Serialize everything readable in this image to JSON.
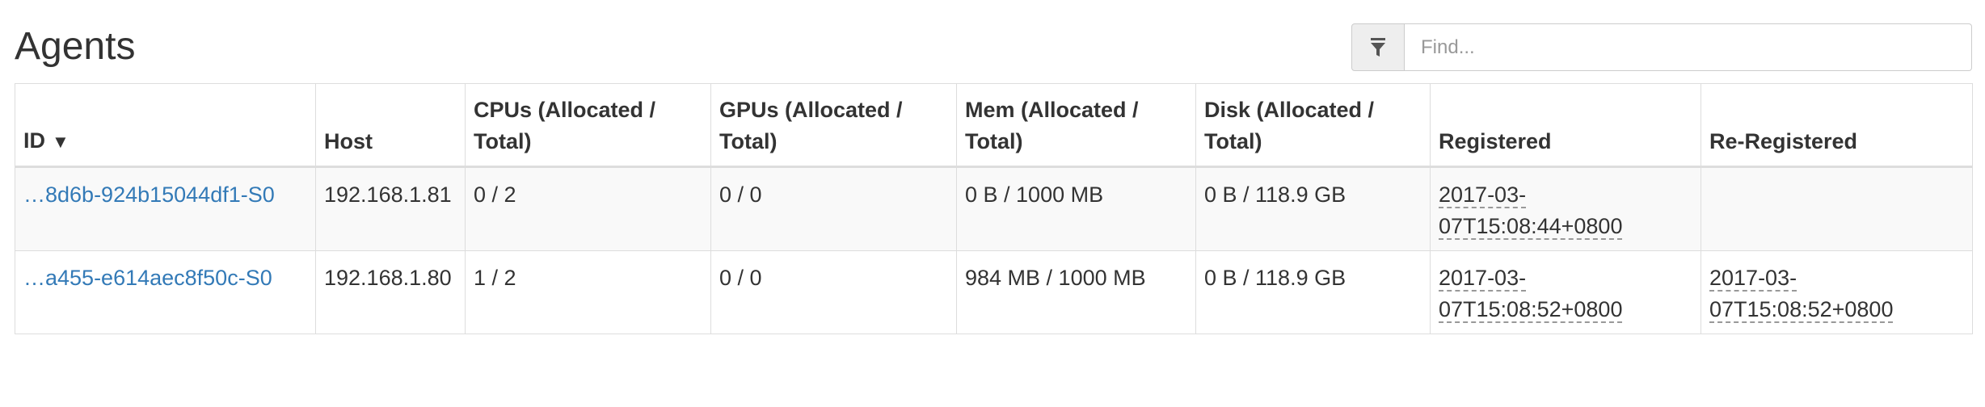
{
  "page": {
    "title": "Agents"
  },
  "search": {
    "placeholder": "Find...",
    "value": "",
    "filter_icon": "filter-icon"
  },
  "table": {
    "columns": [
      {
        "label": "ID",
        "sort_indicator": "▼"
      },
      {
        "label": "Host"
      },
      {
        "label": "CPUs (Allocated / Total)"
      },
      {
        "label": "GPUs (Allocated / Total)"
      },
      {
        "label": "Mem (Allocated / Total)"
      },
      {
        "label": "Disk (Allocated / Total)"
      },
      {
        "label": "Registered"
      },
      {
        "label": "Re-Registered"
      }
    ],
    "rows": [
      {
        "id": "…8d6b-924b15044df1-S0",
        "host": "192.168.1.81",
        "cpus": "0 / 2",
        "gpus": "0 / 0",
        "mem": "0 B / 1000 MB",
        "disk": "0 B / 118.9 GB",
        "registered_date": "2017-03-",
        "registered_time": "07T15:08:44+0800",
        "reregistered_date": "",
        "reregistered_time": ""
      },
      {
        "id": "…a455-e614aec8f50c-S0",
        "host": "192.168.1.80",
        "cpus": "1 / 2",
        "gpus": "0 / 0",
        "mem": "984 MB / 1000 MB",
        "disk": "0 B / 118.9 GB",
        "registered_date": "2017-03-",
        "registered_time": "07T15:08:52+0800",
        "reregistered_date": "2017-03-",
        "reregistered_time": "07T15:08:52+0800"
      }
    ]
  },
  "colors": {
    "link": "#337ab7",
    "text": "#333333",
    "border": "#dddddd",
    "stripe": "#f9f9f9",
    "addon_bg": "#eeeeee"
  }
}
